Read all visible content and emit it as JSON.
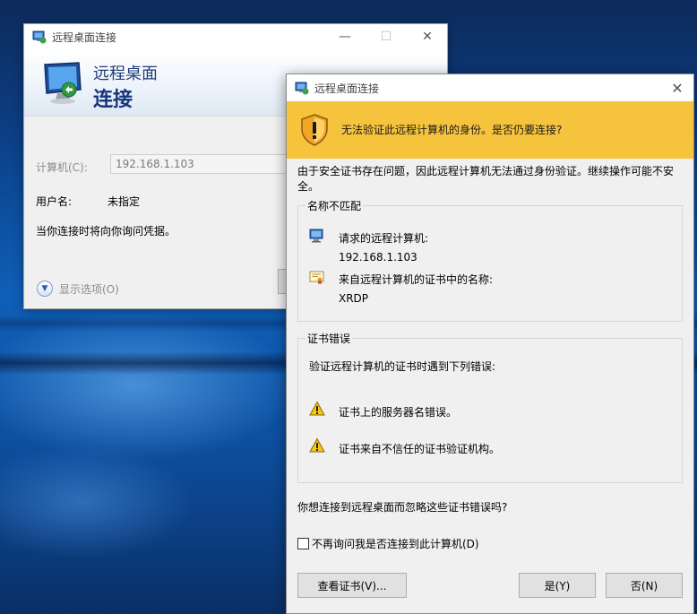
{
  "rdc_window": {
    "title": "远程桌面连接",
    "header_line1": "远程桌面",
    "header_line2": "连接",
    "computer_label": "计算机(C):",
    "computer_value": "192.168.1.103",
    "user_label": "用户名:",
    "user_value": "未指定",
    "prompt_text": "当你连接时将向你询问凭据。",
    "show_options_label": "显示选项(O)"
  },
  "cert_dialog": {
    "title": "远程桌面连接",
    "warning_message": "无法验证此远程计算机的身份。是否仍要连接?",
    "intro_text": "由于安全证书存在问题，因此远程计算机无法通过身份验证。继续操作可能不安全。",
    "name_mismatch": {
      "legend": "名称不匹配",
      "requested_label": "请求的远程计算机:",
      "requested_value": "192.168.1.103",
      "cert_name_label": "来自远程计算机的证书中的名称:",
      "cert_name_value": "XRDP"
    },
    "cert_errors": {
      "legend": "证书错误",
      "intro": "验证远程计算机的证书时遇到下列错误:",
      "errors": [
        "证书上的服务器名错误。",
        "证书来自不信任的证书验证机构。"
      ]
    },
    "question": "你想连接到远程桌面而忽略这些证书错误吗?",
    "checkbox_label": "不再询问我是否连接到此计算机(D)",
    "view_cert_label": "查看证书(V)...",
    "yes_label": "是(Y)",
    "no_label": "否(N)"
  },
  "colors": {
    "warning_banner": "#f6c33c",
    "header_text": "#1f3c78"
  }
}
